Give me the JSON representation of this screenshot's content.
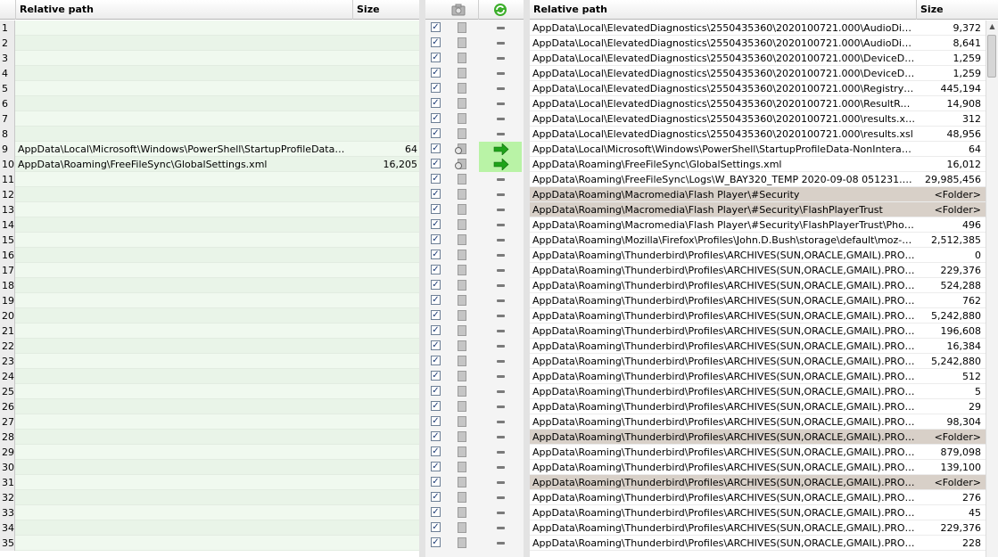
{
  "left": {
    "columns": {
      "path": "Relative path",
      "size": "Size"
    },
    "rows": [
      {
        "n": "1",
        "path": "",
        "size": ""
      },
      {
        "n": "2",
        "path": "",
        "size": ""
      },
      {
        "n": "3",
        "path": "",
        "size": ""
      },
      {
        "n": "4",
        "path": "",
        "size": ""
      },
      {
        "n": "5",
        "path": "",
        "size": ""
      },
      {
        "n": "6",
        "path": "",
        "size": ""
      },
      {
        "n": "7",
        "path": "",
        "size": ""
      },
      {
        "n": "8",
        "path": "",
        "size": ""
      },
      {
        "n": "9",
        "path": "AppData\\Local\\Microsoft\\Windows\\PowerShell\\StartupProfileData-...",
        "size": "64"
      },
      {
        "n": "10",
        "path": "AppData\\Roaming\\FreeFileSync\\GlobalSettings.xml",
        "size": "16,205"
      },
      {
        "n": "11",
        "path": "",
        "size": ""
      },
      {
        "n": "12",
        "path": "",
        "size": ""
      },
      {
        "n": "13",
        "path": "",
        "size": ""
      },
      {
        "n": "14",
        "path": "",
        "size": ""
      },
      {
        "n": "15",
        "path": "",
        "size": ""
      },
      {
        "n": "16",
        "path": "",
        "size": ""
      },
      {
        "n": "17",
        "path": "",
        "size": ""
      },
      {
        "n": "18",
        "path": "",
        "size": ""
      },
      {
        "n": "19",
        "path": "",
        "size": ""
      },
      {
        "n": "20",
        "path": "",
        "size": ""
      },
      {
        "n": "21",
        "path": "",
        "size": ""
      },
      {
        "n": "22",
        "path": "",
        "size": ""
      },
      {
        "n": "23",
        "path": "",
        "size": ""
      },
      {
        "n": "24",
        "path": "",
        "size": ""
      },
      {
        "n": "25",
        "path": "",
        "size": ""
      },
      {
        "n": "26",
        "path": "",
        "size": ""
      },
      {
        "n": "27",
        "path": "",
        "size": ""
      },
      {
        "n": "28",
        "path": "",
        "size": ""
      },
      {
        "n": "29",
        "path": "",
        "size": ""
      },
      {
        "n": "30",
        "path": "",
        "size": ""
      },
      {
        "n": "31",
        "path": "",
        "size": ""
      },
      {
        "n": "32",
        "path": "",
        "size": ""
      },
      {
        "n": "33",
        "path": "",
        "size": ""
      },
      {
        "n": "34",
        "path": "",
        "size": ""
      },
      {
        "n": "35",
        "path": "",
        "size": ""
      }
    ]
  },
  "middle": {
    "header_icons": [
      "camera-icon",
      "sync-icon"
    ],
    "rows": [
      {
        "checked": true,
        "icon": "file",
        "action": "equal"
      },
      {
        "checked": true,
        "icon": "file",
        "action": "equal"
      },
      {
        "checked": true,
        "icon": "file",
        "action": "equal"
      },
      {
        "checked": true,
        "icon": "file",
        "action": "equal"
      },
      {
        "checked": true,
        "icon": "file",
        "action": "equal"
      },
      {
        "checked": true,
        "icon": "file",
        "action": "equal"
      },
      {
        "checked": true,
        "icon": "file",
        "action": "equal"
      },
      {
        "checked": true,
        "icon": "file",
        "action": "equal"
      },
      {
        "checked": true,
        "icon": "compare",
        "action": "right"
      },
      {
        "checked": true,
        "icon": "compare",
        "action": "right"
      },
      {
        "checked": true,
        "icon": "file",
        "action": "equal"
      },
      {
        "checked": true,
        "icon": "file",
        "action": "equal"
      },
      {
        "checked": true,
        "icon": "file",
        "action": "equal"
      },
      {
        "checked": true,
        "icon": "file",
        "action": "equal"
      },
      {
        "checked": true,
        "icon": "file",
        "action": "equal"
      },
      {
        "checked": true,
        "icon": "file",
        "action": "equal"
      },
      {
        "checked": true,
        "icon": "file",
        "action": "equal"
      },
      {
        "checked": true,
        "icon": "file",
        "action": "equal"
      },
      {
        "checked": true,
        "icon": "file",
        "action": "equal"
      },
      {
        "checked": true,
        "icon": "file",
        "action": "equal"
      },
      {
        "checked": true,
        "icon": "file",
        "action": "equal"
      },
      {
        "checked": true,
        "icon": "file",
        "action": "equal"
      },
      {
        "checked": true,
        "icon": "file",
        "action": "equal"
      },
      {
        "checked": true,
        "icon": "file",
        "action": "equal"
      },
      {
        "checked": true,
        "icon": "file",
        "action": "equal"
      },
      {
        "checked": true,
        "icon": "file",
        "action": "equal"
      },
      {
        "checked": true,
        "icon": "file",
        "action": "equal"
      },
      {
        "checked": true,
        "icon": "file",
        "action": "equal"
      },
      {
        "checked": true,
        "icon": "file",
        "action": "equal"
      },
      {
        "checked": true,
        "icon": "file",
        "action": "equal"
      },
      {
        "checked": true,
        "icon": "file",
        "action": "equal"
      },
      {
        "checked": true,
        "icon": "file",
        "action": "equal"
      },
      {
        "checked": true,
        "icon": "file",
        "action": "equal"
      },
      {
        "checked": true,
        "icon": "file",
        "action": "equal"
      },
      {
        "checked": true,
        "icon": "file",
        "action": "equal"
      }
    ]
  },
  "right": {
    "columns": {
      "path": "Relative path",
      "size": "Size"
    },
    "rows": [
      {
        "path": "AppData\\Local\\ElevatedDiagnostics\\2550435360\\2020100721.000\\AudioDiagnos...",
        "size": "9,372",
        "folder": false
      },
      {
        "path": "AppData\\Local\\ElevatedDiagnostics\\2550435360\\2020100721.000\\AudioDiagnos...",
        "size": "8,641",
        "folder": false
      },
      {
        "path": "AppData\\Local\\ElevatedDiagnostics\\2550435360\\2020100721.000\\DeviceDiagno...",
        "size": "1,259",
        "folder": false
      },
      {
        "path": "AppData\\Local\\ElevatedDiagnostics\\2550435360\\2020100721.000\\DeviceDiagno...",
        "size": "1,259",
        "folder": false
      },
      {
        "path": "AppData\\Local\\ElevatedDiagnostics\\2550435360\\2020100721.000\\Registry log.reg",
        "size": "445,194",
        "folder": false
      },
      {
        "path": "AppData\\Local\\ElevatedDiagnostics\\2550435360\\2020100721.000\\ResultReport.x...",
        "size": "14,908",
        "folder": false
      },
      {
        "path": "AppData\\Local\\ElevatedDiagnostics\\2550435360\\2020100721.000\\results.xml",
        "size": "312",
        "folder": false
      },
      {
        "path": "AppData\\Local\\ElevatedDiagnostics\\2550435360\\2020100721.000\\results.xsl",
        "size": "48,956",
        "folder": false
      },
      {
        "path": "AppData\\Local\\Microsoft\\Windows\\PowerShell\\StartupProfileData-NonInteract...",
        "size": "64",
        "folder": false
      },
      {
        "path": "AppData\\Roaming\\FreeFileSync\\GlobalSettings.xml",
        "size": "16,012",
        "folder": false
      },
      {
        "path": "AppData\\Roaming\\FreeFileSync\\Logs\\W_BAY320_TEMP 2020-09-08 051231.936....",
        "size": "29,985,456",
        "folder": false
      },
      {
        "path": "AppData\\Roaming\\Macromedia\\Flash Player\\#Security",
        "size": "<Folder>",
        "folder": true
      },
      {
        "path": "AppData\\Roaming\\Macromedia\\Flash Player\\#Security\\FlashPlayerTrust",
        "size": "<Folder>",
        "folder": true
      },
      {
        "path": "AppData\\Roaming\\Macromedia\\Flash Player\\#Security\\FlashPlayerTrust\\Photo...",
        "size": "496",
        "folder": false
      },
      {
        "path": "AppData\\Roaming\\Mozilla\\Firefox\\Profiles\\John.D.Bush\\storage\\default\\moz-e...",
        "size": "2,512,385",
        "folder": false
      },
      {
        "path": "AppData\\Roaming\\Thunderbird\\Profiles\\ARCHIVES(SUN,ORACLE,GMAIL).PROF...",
        "size": "0",
        "folder": false
      },
      {
        "path": "AppData\\Roaming\\Thunderbird\\Profiles\\ARCHIVES(SUN,ORACLE,GMAIL).PROF...",
        "size": "229,376",
        "folder": false
      },
      {
        "path": "AppData\\Roaming\\Thunderbird\\Profiles\\ARCHIVES(SUN,ORACLE,GMAIL).PROF...",
        "size": "524,288",
        "folder": false
      },
      {
        "path": "AppData\\Roaming\\Thunderbird\\Profiles\\ARCHIVES(SUN,ORACLE,GMAIL).PROF...",
        "size": "762",
        "folder": false
      },
      {
        "path": "AppData\\Roaming\\Thunderbird\\Profiles\\ARCHIVES(SUN,ORACLE,GMAIL).PROF...",
        "size": "5,242,880",
        "folder": false
      },
      {
        "path": "AppData\\Roaming\\Thunderbird\\Profiles\\ARCHIVES(SUN,ORACLE,GMAIL).PROF...",
        "size": "196,608",
        "folder": false
      },
      {
        "path": "AppData\\Roaming\\Thunderbird\\Profiles\\ARCHIVES(SUN,ORACLE,GMAIL).PROF...",
        "size": "16,384",
        "folder": false
      },
      {
        "path": "AppData\\Roaming\\Thunderbird\\Profiles\\ARCHIVES(SUN,ORACLE,GMAIL).PROF...",
        "size": "5,242,880",
        "folder": false
      },
      {
        "path": "AppData\\Roaming\\Thunderbird\\Profiles\\ARCHIVES(SUN,ORACLE,GMAIL).PROF...",
        "size": "512",
        "folder": false
      },
      {
        "path": "AppData\\Roaming\\Thunderbird\\Profiles\\ARCHIVES(SUN,ORACLE,GMAIL).PROF...",
        "size": "5",
        "folder": false
      },
      {
        "path": "AppData\\Roaming\\Thunderbird\\Profiles\\ARCHIVES(SUN,ORACLE,GMAIL).PROF...",
        "size": "29",
        "folder": false
      },
      {
        "path": "AppData\\Roaming\\Thunderbird\\Profiles\\ARCHIVES(SUN,ORACLE,GMAIL).PROF...",
        "size": "98,304",
        "folder": false
      },
      {
        "path": "AppData\\Roaming\\Thunderbird\\Profiles\\ARCHIVES(SUN,ORACLE,GMAIL).PROF...",
        "size": "<Folder>",
        "folder": true
      },
      {
        "path": "AppData\\Roaming\\Thunderbird\\Profiles\\ARCHIVES(SUN,ORACLE,GMAIL).PROF...",
        "size": "879,098",
        "folder": false
      },
      {
        "path": "AppData\\Roaming\\Thunderbird\\Profiles\\ARCHIVES(SUN,ORACLE,GMAIL).PROF...",
        "size": "139,100",
        "folder": false
      },
      {
        "path": "AppData\\Roaming\\Thunderbird\\Profiles\\ARCHIVES(SUN,ORACLE,GMAIL).PROF...",
        "size": "<Folder>",
        "folder": true
      },
      {
        "path": "AppData\\Roaming\\Thunderbird\\Profiles\\ARCHIVES(SUN,ORACLE,GMAIL).PROF...",
        "size": "276",
        "folder": false
      },
      {
        "path": "AppData\\Roaming\\Thunderbird\\Profiles\\ARCHIVES(SUN,ORACLE,GMAIL).PROF...",
        "size": "45",
        "folder": false
      },
      {
        "path": "AppData\\Roaming\\Thunderbird\\Profiles\\ARCHIVES(SUN,ORACLE,GMAIL).PROF...",
        "size": "229,376",
        "folder": false
      },
      {
        "path": "AppData\\Roaming\\Thunderbird\\Profiles\\ARCHIVES(SUN,ORACLE,GMAIL).PROF...",
        "size": "228",
        "folder": false
      }
    ]
  },
  "colors": {
    "action_active": "#b9f3a6",
    "arrow_green": "#1fa31a",
    "folder_row": "#d8d0c8",
    "left_bg": "#f0f9ef"
  }
}
